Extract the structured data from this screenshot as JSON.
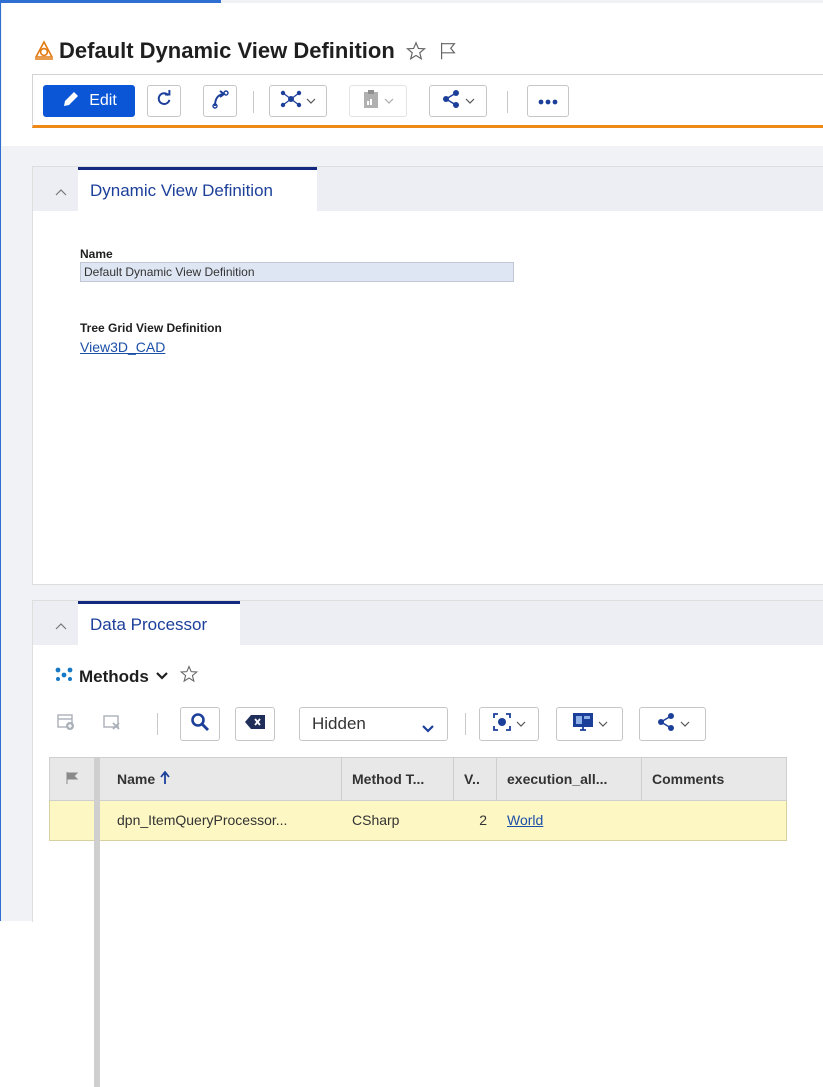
{
  "header": {
    "title": "Default Dynamic View Definition",
    "toolbar": {
      "edit_label": "Edit"
    }
  },
  "form_panel": {
    "tab_label": "Dynamic View Definition",
    "name_label": "Name",
    "name_value": "Default Dynamic View Definition",
    "tree_grid_label": "Tree Grid View Definition",
    "tree_grid_value": "View3D_CAD"
  },
  "relationship_panel": {
    "tab_label": "Data Processor",
    "grid_title": "Methods",
    "view_select_value": "Hidden",
    "columns": [
      "Name",
      "Method T...",
      "V..",
      "execution_all...",
      "Comments"
    ],
    "rows": [
      {
        "name": "dpn_ItemQueryProcessor...",
        "method_type": "CSharp",
        "version": "2",
        "execution_allowed": "World",
        "comments": ""
      }
    ]
  },
  "colors": {
    "accent_blue": "#0a56d6",
    "tab_navy": "#12297f",
    "toolbar_orange": "#f08a17",
    "selected_row": "#fdf7c4",
    "link": "#1b4fa8"
  },
  "icons": [
    "item-type-icon",
    "star-icon",
    "flag-icon",
    "pencil-icon",
    "refresh-icon",
    "workflow-icon",
    "network-icon",
    "report-icon",
    "share-icon",
    "more-icon",
    "chevron-up-icon",
    "methods-icon",
    "chevron-down-icon",
    "add-row-icon",
    "delete-row-icon",
    "search-icon",
    "clear-icon",
    "camera-icon",
    "layout-icon",
    "sort-asc-icon"
  ]
}
